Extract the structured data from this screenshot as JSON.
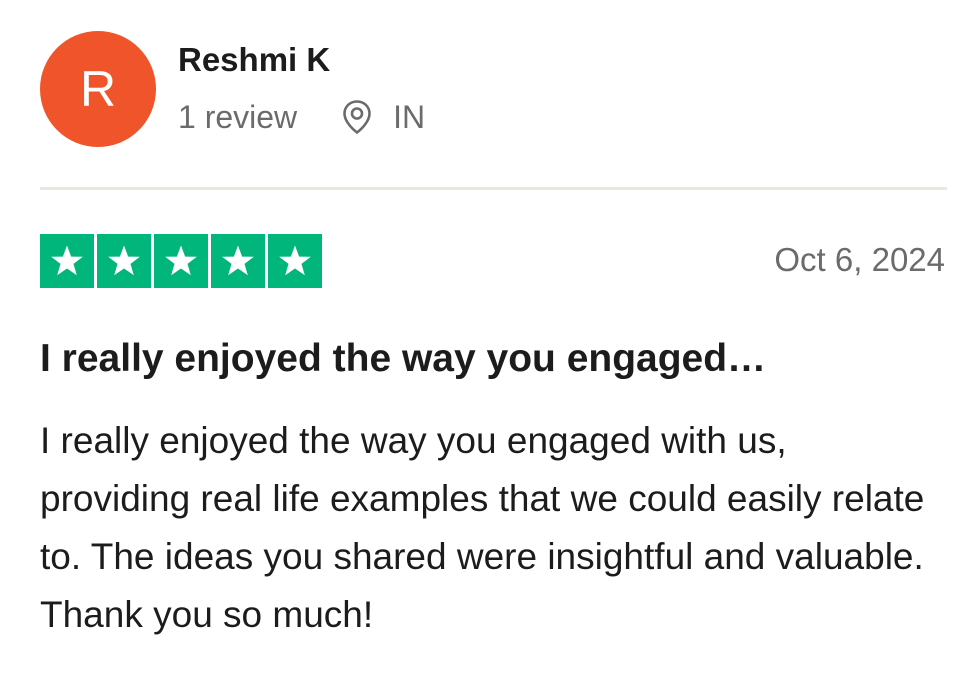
{
  "reviewer": {
    "avatar_initial": "R",
    "avatar_color": "#f0542b",
    "name": "Reshmi K",
    "review_count": "1 review",
    "location_icon": "map-pin-icon",
    "location": "IN"
  },
  "review": {
    "rating": 5,
    "rating_max": 5,
    "star_color": "#00b67a",
    "date": "Oct 6, 2024",
    "title": "I really enjoyed the way you engaged…",
    "body": "I really enjoyed the way you engaged with us, providing real life examples that we could easily relate to. The ideas you shared were insightful and valuable. Thank you so much!"
  }
}
